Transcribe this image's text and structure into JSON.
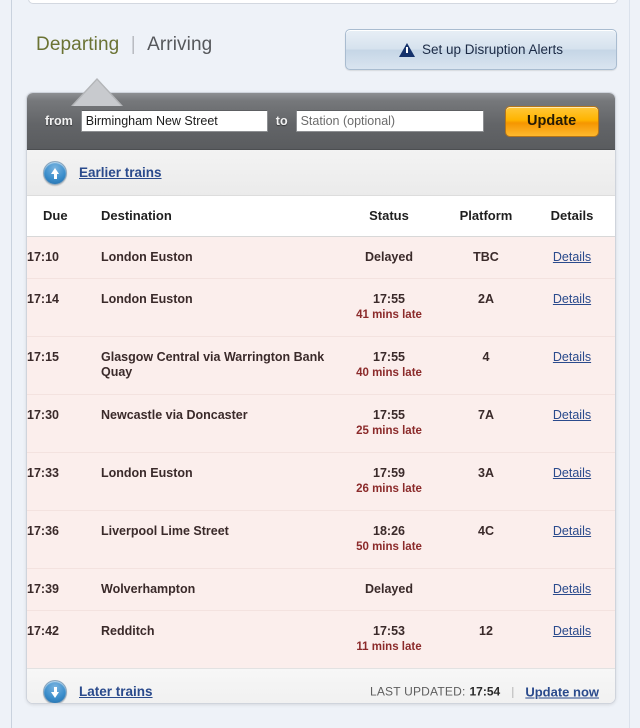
{
  "tabs": {
    "departing_label": "Departing",
    "separator": "|",
    "arriving_label": "Arriving"
  },
  "alerts_button": {
    "label": "Set up Disruption Alerts",
    "icon": "warning-triangle-icon"
  },
  "search": {
    "from_label": "from",
    "from_value": "Birmingham New Street",
    "to_label": "to",
    "to_value": "",
    "to_placeholder": "Station (optional)",
    "update_label": "Update"
  },
  "earlier": {
    "label": "Earlier trains",
    "icon": "arrow-up-circle-icon"
  },
  "later": {
    "label": "Later trains",
    "icon": "arrow-down-circle-icon"
  },
  "footer": {
    "last_updated_label": "LAST UPDATED:",
    "last_updated_time": "17:54",
    "separator": "|",
    "update_now_label": "Update now"
  },
  "table": {
    "headers": {
      "due": "Due",
      "destination": "Destination",
      "status": "Status",
      "platform": "Platform",
      "details": "Details"
    },
    "details_link_label": "Details",
    "rows": [
      {
        "due": "17:10",
        "destination": "London Euston",
        "status": "Delayed",
        "late": "",
        "platform": "TBC",
        "details": "Details"
      },
      {
        "due": "17:14",
        "destination": "London Euston",
        "status": "17:55",
        "late": "41 mins late",
        "platform": "2A",
        "details": "Details"
      },
      {
        "due": "17:15",
        "destination": "Glasgow Central via Warrington Bank Quay",
        "status": "17:55",
        "late": "40 mins late",
        "platform": "4",
        "details": "Details"
      },
      {
        "due": "17:30",
        "destination": "Newcastle via Doncaster",
        "status": "17:55",
        "late": "25 mins late",
        "platform": "7A",
        "details": "Details"
      },
      {
        "due": "17:33",
        "destination": "London Euston",
        "status": "17:59",
        "late": "26 mins late",
        "platform": "3A",
        "details": "Details"
      },
      {
        "due": "17:36",
        "destination": "Liverpool Lime Street",
        "status": "18:26",
        "late": "50 mins late",
        "platform": "4C",
        "details": "Details"
      },
      {
        "due": "17:39",
        "destination": "Wolverhampton",
        "status": "Delayed",
        "late": "",
        "platform": "",
        "details": "Details"
      },
      {
        "due": "17:42",
        "destination": "Redditch",
        "status": "17:53",
        "late": "11 mins late",
        "platform": "12",
        "details": "Details"
      }
    ]
  },
  "colors": {
    "page_background": "#eef2f8",
    "departing_tab": "#6b7334",
    "arriving_tab": "#56585c",
    "link": "#2a4a8c",
    "delay_text": "#8b2a2a",
    "delay_row_background": "#fbeeec",
    "update_button": "#ffb400",
    "search_bar": "#636568"
  }
}
